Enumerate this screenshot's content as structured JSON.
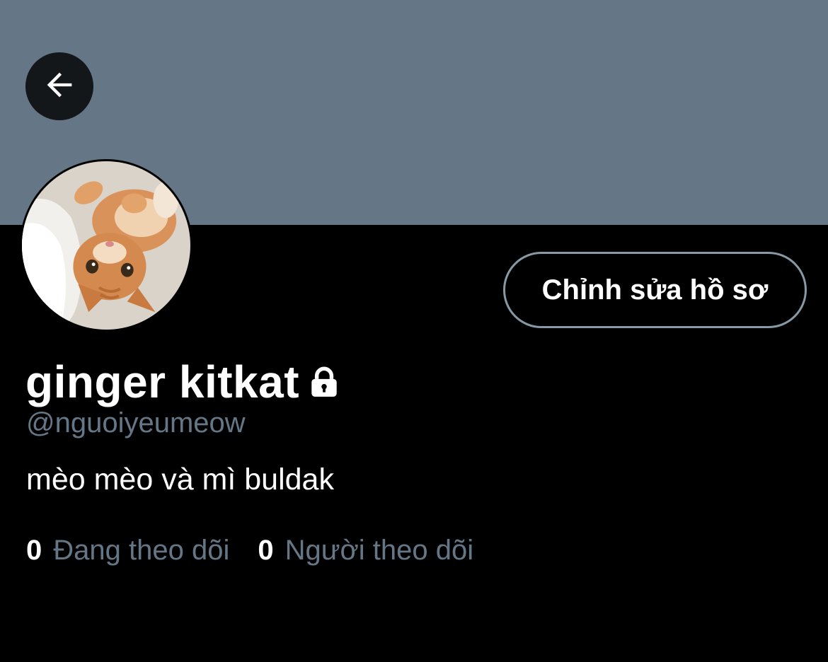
{
  "header": {
    "banner_color": "#657786",
    "back_icon": "arrow-left-icon"
  },
  "profile": {
    "avatar_alt": "orange kitten avatar",
    "display_name": "ginger kitkat",
    "protected_icon": "lock-icon",
    "handle": "@nguoiyeumeow",
    "bio": "mèo mèo và mì buldak",
    "edit_button_label": "Chỉnh sửa hồ sơ"
  },
  "stats": {
    "following_count": "0",
    "following_label": "Đang theo dõi",
    "followers_count": "0",
    "followers_label": "Người theo dõi"
  },
  "colors": {
    "background": "#000000",
    "secondary_text": "#657786",
    "button_border": "#8899a6"
  }
}
